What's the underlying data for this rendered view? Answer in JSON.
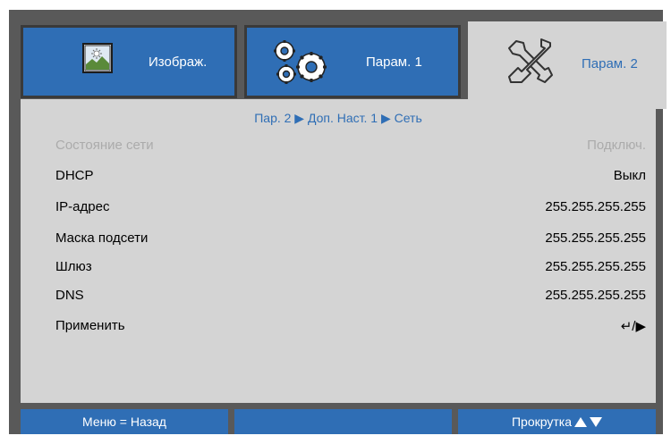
{
  "tabs": [
    {
      "label": "Изображ.",
      "icon": "image-adjust-icon",
      "active": false
    },
    {
      "label": "Парам. 1",
      "icon": "gears-icon",
      "active": false
    },
    {
      "label": "Парам. 2",
      "icon": "wrench-screwdriver-icon",
      "active": true
    }
  ],
  "breadcrumb": "Пар. 2 ▶ Доп. Наст. 1 ▶ Сеть",
  "rows": [
    {
      "label": "Состояние сети",
      "value": "Подключ.",
      "disabled": true
    },
    {
      "label": "DHCP",
      "value": "Выкл"
    },
    {
      "label": "IP-адрес",
      "value": "255.255.255.255"
    },
    {
      "label": "Маска подсети",
      "value": "255.255.255.255"
    },
    {
      "label": "Шлюз",
      "value": "255.255.255.255"
    },
    {
      "label": "DNS",
      "value": "255.255.255.255"
    },
    {
      "label": "Применить",
      "value": "↵/▶"
    }
  ],
  "footer": {
    "left": "Меню = Назад",
    "middle": "",
    "right": "Прокрутка"
  },
  "colors": {
    "accent": "#2f6eb5",
    "frame": "#595959",
    "panel": "#d4d4d4",
    "disabled_text": "#ababab"
  }
}
